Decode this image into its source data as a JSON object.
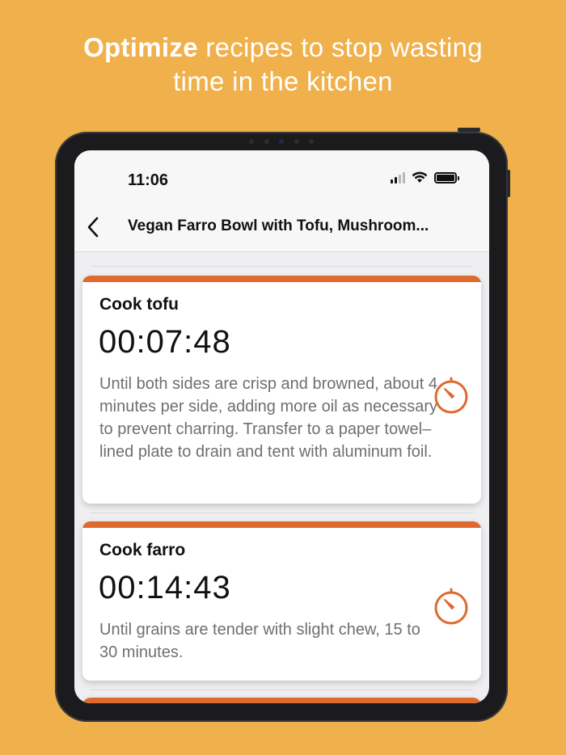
{
  "headline": {
    "bold": "Optimize",
    "rest": " recipes to stop wasting",
    "line2": "time in the kitchen"
  },
  "status": {
    "time": "11:06"
  },
  "nav": {
    "back_icon": "chevron-left-icon",
    "title": "Vegan Farro Bowl with Tofu, Mushroom..."
  },
  "steps": [
    {
      "title": "Cook tofu",
      "timer": "00:07:48",
      "description": "Until both sides are crisp and browned, about 4 minutes per side, adding more oil as necessary to prevent charring. Transfer to a paper towel–lined plate to drain and tent with aluminum foil.",
      "icon": "timer-icon"
    },
    {
      "title": "Cook farro",
      "timer": "00:14:43",
      "description": "Until grains are tender with slight chew, 15 to 30 minutes.",
      "icon": "timer-icon"
    }
  ],
  "colors": {
    "background": "#F0B04B",
    "accent": "#DE6A30"
  }
}
